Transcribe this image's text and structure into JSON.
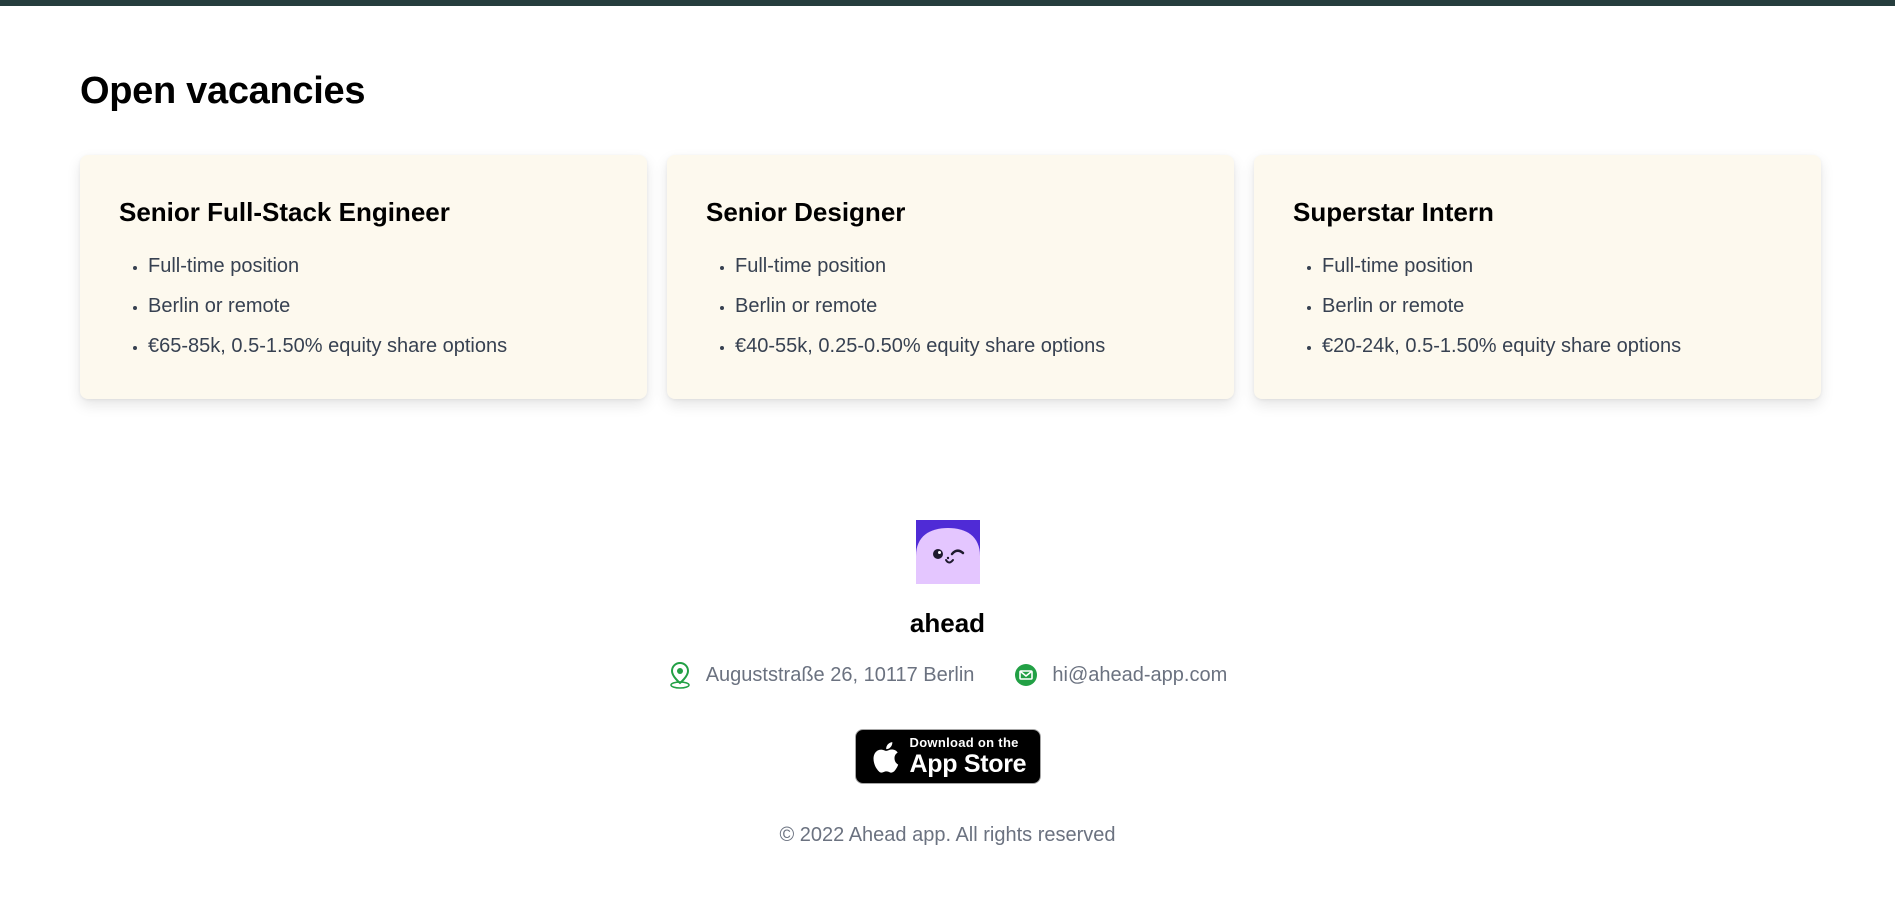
{
  "section_title": "Open vacancies",
  "vacancies": [
    {
      "title": "Senior Full-Stack Engineer",
      "details": [
        "Full-time position",
        "Berlin or remote",
        "€65-85k, 0.5-1.50% equity share options"
      ]
    },
    {
      "title": "Senior Designer",
      "details": [
        "Full-time position",
        "Berlin or remote",
        "€40-55k, 0.25-0.50% equity share options"
      ]
    },
    {
      "title": "Superstar Intern",
      "details": [
        "Full-time position",
        "Berlin or remote",
        "€20-24k, 0.5-1.50% equity share options"
      ]
    }
  ],
  "footer": {
    "brand": "ahead",
    "address": "Auguststraße 26, 10117 Berlin",
    "email": "hi@ahead-app.com",
    "appstore": {
      "small": "Download on the",
      "big": "App Store"
    },
    "copyright": "© 2022 Ahead app. All rights reserved"
  },
  "icons": {
    "logo": "ahead-logo-icon",
    "address": "location-pin-icon",
    "email": "mail-icon",
    "appstore": "apple-icon"
  },
  "colors": {
    "topbar": "#263d3d",
    "card_bg": "#fdf9ee",
    "accent_green": "#22a045",
    "logo_purple": "#4f2bd6",
    "logo_lavender": "#e4c6ff"
  }
}
